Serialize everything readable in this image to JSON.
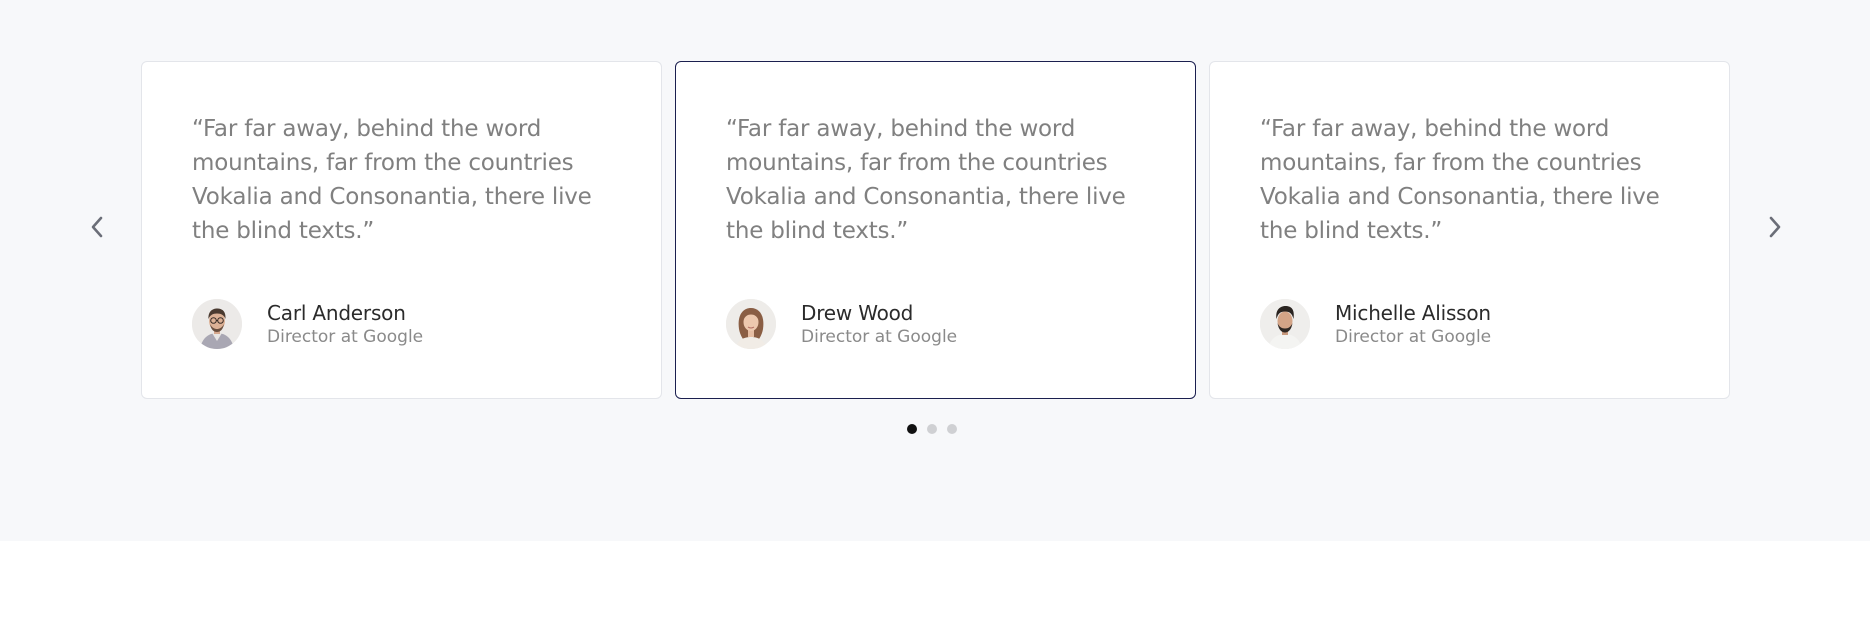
{
  "carousel": {
    "prev_icon": "chevron-left-icon",
    "next_icon": "chevron-right-icon",
    "active_index": 1,
    "dot_count": 3,
    "active_dot": 0,
    "colors": {
      "section_background": "#f7f8fa",
      "active_card_border": "#1b1f4f",
      "card_border": "#e3e5ea",
      "quote_text": "#808080",
      "active_dot": "#111111",
      "inactive_dot": "#cfd0d3"
    },
    "testimonials": [
      {
        "quote": "“Far far away, behind the word mountains, far from the countries Vokalia and Consonantia, there live the blind texts.”",
        "name": "Carl Anderson",
        "role": "Director at Google",
        "avatar": "avatar-man-glasses"
      },
      {
        "quote": "“Far far away, behind the word mountains, far from the countries Vokalia and Consonantia, there live the blind texts.”",
        "name": "Drew Wood",
        "role": "Director at Google",
        "avatar": "avatar-woman"
      },
      {
        "quote": "“Far far away, behind the word mountains, far from the countries Vokalia and Consonantia, there live the blind texts.”",
        "name": "Michelle Alisson",
        "role": "Director at Google",
        "avatar": "avatar-man-beard"
      }
    ]
  }
}
